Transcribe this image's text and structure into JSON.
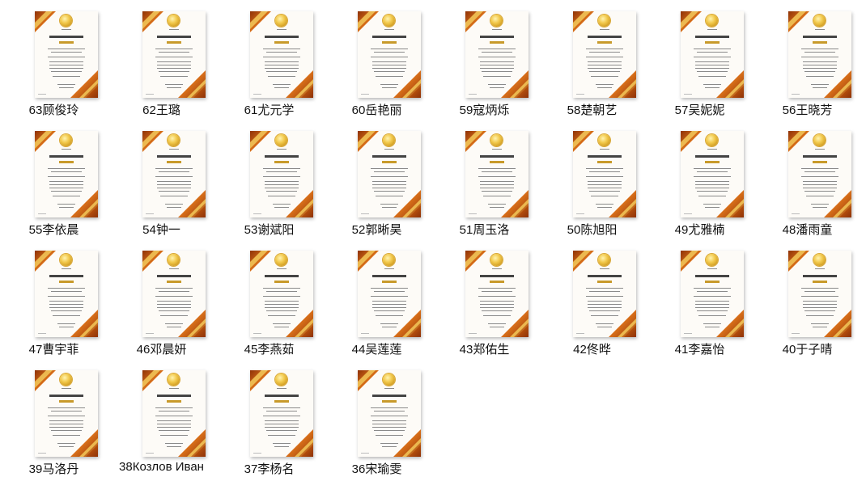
{
  "files": [
    {
      "label": "63顾俊玲"
    },
    {
      "label": "62王璐"
    },
    {
      "label": "61尤元学"
    },
    {
      "label": "60岳艳丽"
    },
    {
      "label": "59寇炳烁"
    },
    {
      "label": "58楚朝艺"
    },
    {
      "label": "57吴妮妮"
    },
    {
      "label": "56王晓芳"
    },
    {
      "label": "55李依晨"
    },
    {
      "label": "54钟一"
    },
    {
      "label": "53谢斌阳"
    },
    {
      "label": "52郭晰昊"
    },
    {
      "label": "51周玉洛"
    },
    {
      "label": "50陈旭阳"
    },
    {
      "label": "49尤雅楠"
    },
    {
      "label": "48潘雨童"
    },
    {
      "label": "47曹宇菲"
    },
    {
      "label": "46邓晨妍"
    },
    {
      "label": "45李燕茹"
    },
    {
      "label": "44吴莲莲"
    },
    {
      "label": "43郑佑生"
    },
    {
      "label": "42佟晔"
    },
    {
      "label": "41李嘉怡"
    },
    {
      "label": "40于子晴"
    },
    {
      "label": "39马洛丹"
    },
    {
      "label": "38Козлов Иван"
    },
    {
      "label": "37李杨名"
    },
    {
      "label": "36宋瑜雯"
    }
  ],
  "colors": {
    "ribbon_dark": "#a0400a",
    "ribbon_mid": "#d9701a",
    "ribbon_gold": "#f0c048",
    "medal": "#f2c94c"
  }
}
